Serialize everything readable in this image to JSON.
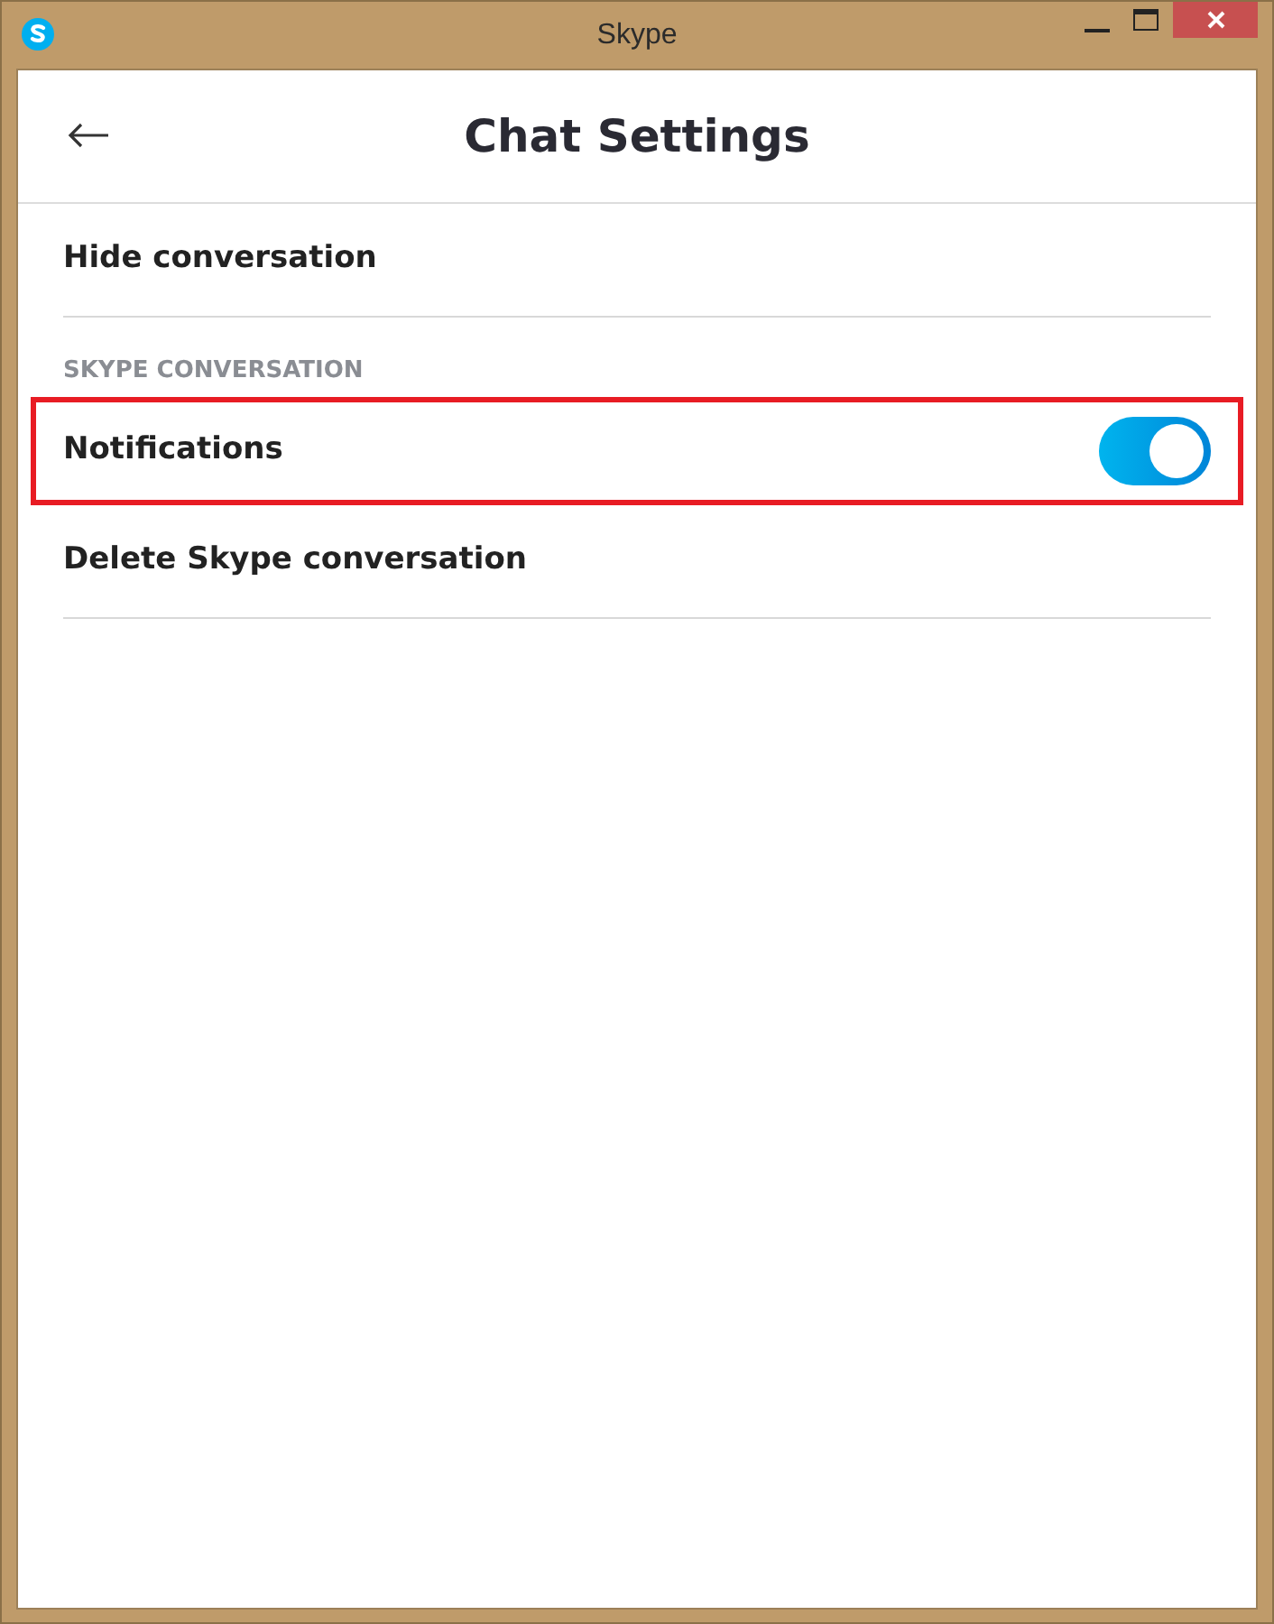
{
  "window": {
    "title": "Skype"
  },
  "header": {
    "title": "Chat Settings"
  },
  "items": [
    {
      "kind": "action",
      "label": "Hide conversation",
      "highlighted": false
    },
    {
      "kind": "section",
      "label": "SKYPE CONVERSATION"
    },
    {
      "kind": "toggle",
      "label": "Notifications",
      "on": true,
      "highlighted": true
    },
    {
      "kind": "action",
      "label": "Delete Skype conversation",
      "highlighted": false
    }
  ]
}
